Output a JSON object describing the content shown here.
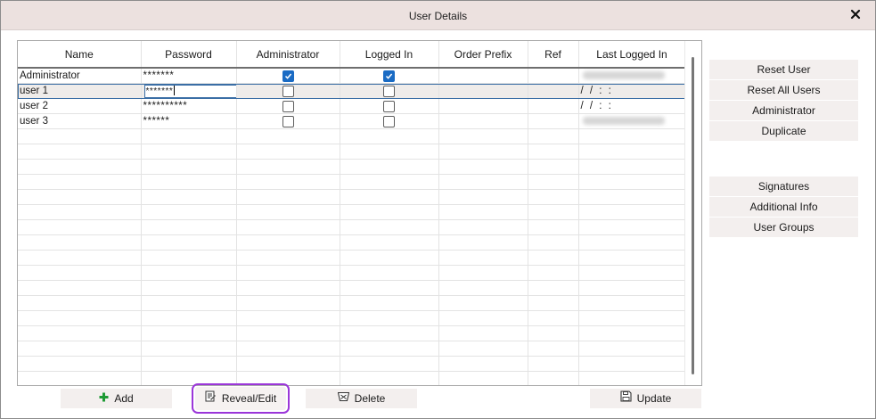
{
  "window": {
    "title": "User Details"
  },
  "grid": {
    "columns": [
      "Name",
      "Password",
      "Administrator",
      "Logged In",
      "Order Prefix",
      "Ref",
      "Last Logged In"
    ],
    "rows": [
      {
        "name": "Administrator",
        "password": "*******",
        "administrator": true,
        "logged_in": true,
        "order_prefix": "",
        "ref": "",
        "last_logged_in": ""
      },
      {
        "name": "user 1",
        "password": "*******",
        "administrator": false,
        "logged_in": false,
        "order_prefix": "",
        "ref": "",
        "last_logged_in": "/ /   : :"
      },
      {
        "name": "user 2",
        "password": "**********",
        "administrator": false,
        "logged_in": false,
        "order_prefix": "",
        "ref": "",
        "last_logged_in": "/ /   : :"
      },
      {
        "name": "user 3",
        "password": "******",
        "administrator": false,
        "logged_in": false,
        "order_prefix": "",
        "ref": "",
        "last_logged_in": ""
      }
    ],
    "selected_row": 1
  },
  "side_buttons": {
    "reset_user": "Reset User",
    "reset_all_users": "Reset All Users",
    "administrator": "Administrator",
    "duplicate": "Duplicate",
    "signatures": "Signatures",
    "additional_info": "Additional Info",
    "user_groups": "User Groups"
  },
  "bottom_buttons": {
    "add": "Add",
    "reveal_edit": "Reveal/Edit",
    "delete": "Delete",
    "update": "Update"
  },
  "icons": {
    "close": "close-icon",
    "add": "plus-icon",
    "reveal_edit": "edit-document-icon",
    "delete": "trash-icon",
    "update": "save-disk-icon"
  },
  "colors": {
    "titlebar": "#ece1df",
    "button_bg": "#f3efee",
    "checkbox_checked": "#1a6bc4",
    "add_icon": "#1e9a34",
    "highlight_outline": "#9b36d9",
    "selection_border": "#3a6ea5"
  }
}
